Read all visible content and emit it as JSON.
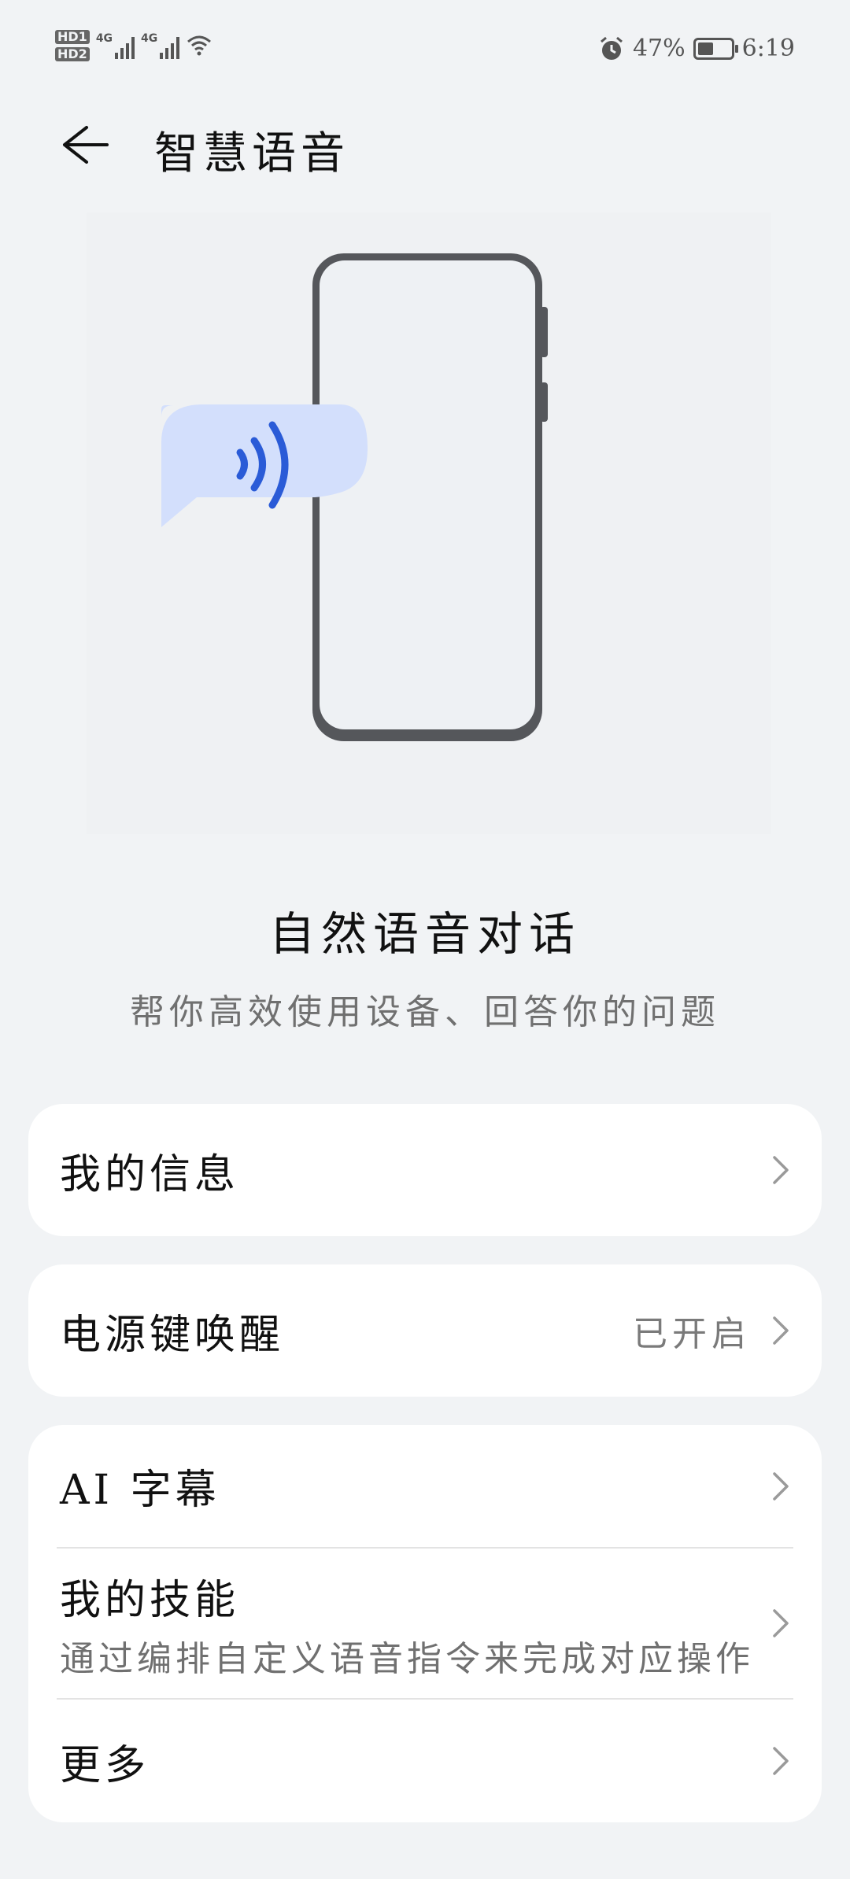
{
  "status_bar": {
    "sim1": "HD1",
    "sim2": "HD2",
    "net1": "4G",
    "net2": "4G",
    "battery_percent": "47%",
    "battery_level": 0.47,
    "time": "6:19",
    "icons": [
      "alarm-icon",
      "battery-icon",
      "wifi-icon",
      "signal-icon"
    ]
  },
  "header": {
    "title": "智慧语音"
  },
  "feature": {
    "title": "自然语音对话",
    "subtitle": "帮你高效使用设备、回答你的问题"
  },
  "cards": {
    "my_info": {
      "label": "我的信息"
    },
    "power_wake": {
      "label": "电源键唤醒",
      "value": "已开启"
    },
    "ai_subtitle": {
      "label": "AI 字幕"
    },
    "my_skills": {
      "label": "我的技能",
      "sub": "通过编排自定义语音指令来完成对应操作"
    },
    "more": {
      "label": "更多"
    }
  },
  "colors": {
    "background": "#f1f3f5",
    "card": "#ffffff",
    "accent_blue": "#2a5bd7",
    "bubble": "#d3dffc",
    "phone_frame": "#55575b"
  }
}
